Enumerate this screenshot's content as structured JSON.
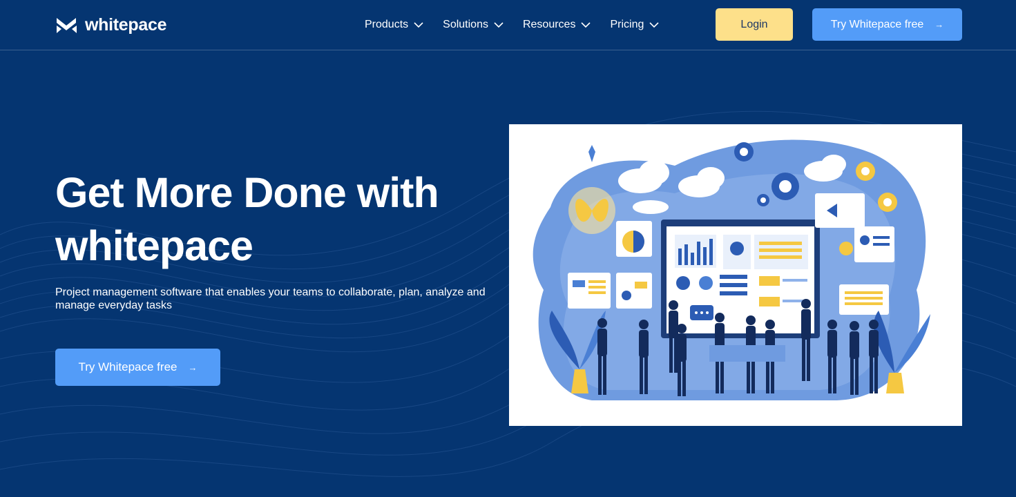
{
  "brand": {
    "name": "whitepace",
    "logo_icon": "whitepace-logo-icon"
  },
  "nav": {
    "items": [
      {
        "label": "Products",
        "icon": "chevron-down-icon"
      },
      {
        "label": "Solutions",
        "icon": "chevron-down-icon"
      },
      {
        "label": "Resources",
        "icon": "chevron-down-icon"
      },
      {
        "label": "Pricing",
        "icon": "chevron-down-icon"
      }
    ],
    "login_label": "Login",
    "cta_label": "Try Whitepace free",
    "cta_icon": "arrow-right-icon"
  },
  "hero": {
    "title": "Get More Done with whitepace",
    "subtitle": "Project management software that enables your teams to collaborate, plan, analyze and manage everyday tasks",
    "cta_label": "Try Whitepace free",
    "cta_icon": "arrow-right-icon",
    "illustration": "team-collaboration-dashboard-illustration"
  },
  "colors": {
    "background": "#053571",
    "login_button": "#fde08a",
    "cta_button": "#539cf8",
    "accent_yellow": "#f5c842",
    "accent_blue": "#4a7fd4"
  },
  "arrow_glyph": "→"
}
